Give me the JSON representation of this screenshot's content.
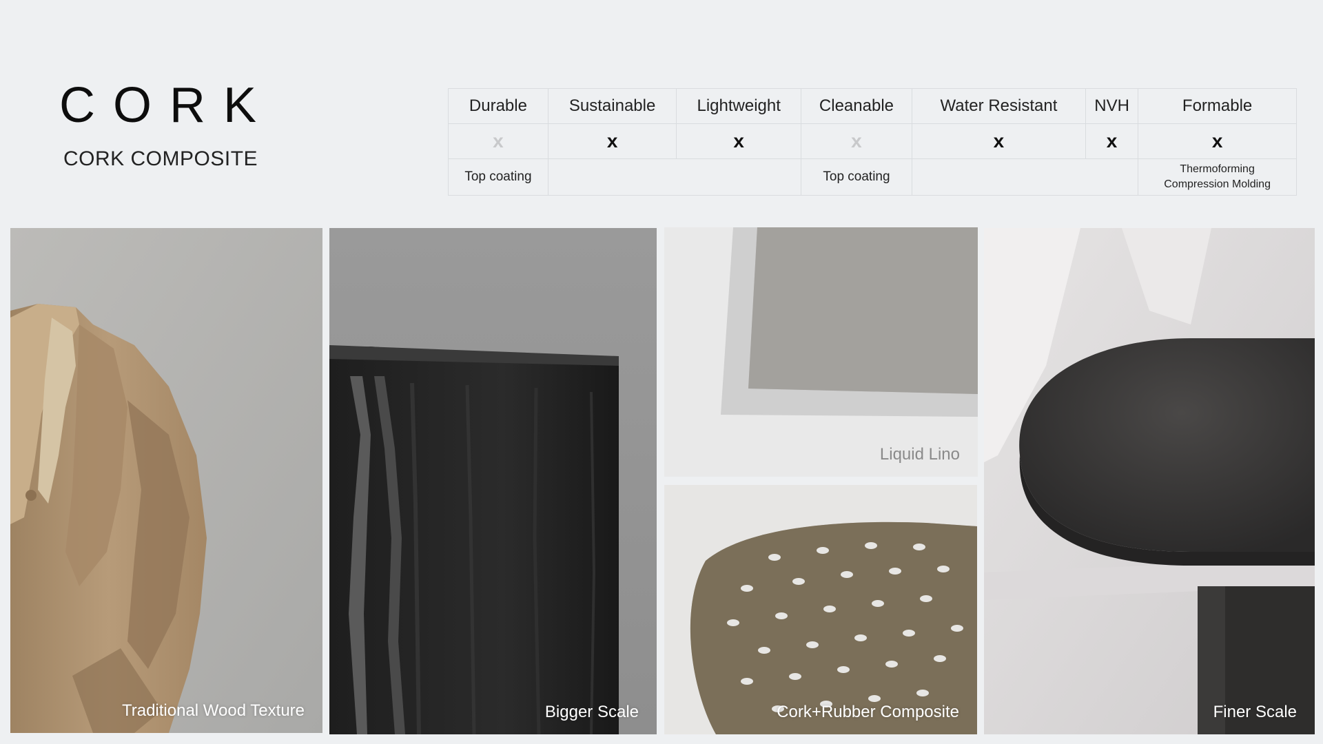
{
  "header": {
    "title": "CORK",
    "subtitle": "CORK COMPOSITE"
  },
  "properties": {
    "columns": [
      "Durable",
      "Sustainable",
      "Lightweight",
      "Cleanable",
      "Water Resistant",
      "NVH",
      "Formable"
    ],
    "marks": [
      {
        "symbol": "x",
        "state": "partial"
      },
      {
        "symbol": "x",
        "state": "full"
      },
      {
        "symbol": "x",
        "state": "full"
      },
      {
        "symbol": "x",
        "state": "partial"
      },
      {
        "symbol": "x",
        "state": "full"
      },
      {
        "symbol": "x",
        "state": "full"
      },
      {
        "symbol": "x",
        "state": "full"
      }
    ],
    "notes": {
      "durable": "Top coating",
      "cleanable": "Top coating",
      "formable_line1": "Thermoforming",
      "formable_line2": "Compression Molding"
    }
  },
  "gallery": [
    {
      "caption": "Traditional Wood Texture"
    },
    {
      "caption": "Bigger Scale"
    },
    {
      "caption": "Liquid Lino"
    },
    {
      "caption": "Cork+Rubber Composite"
    },
    {
      "caption": "Finer Scale"
    }
  ],
  "colors": {
    "background": "#eef0f2",
    "mark_full": "#111111",
    "mark_partial": "#c8c9cb"
  }
}
